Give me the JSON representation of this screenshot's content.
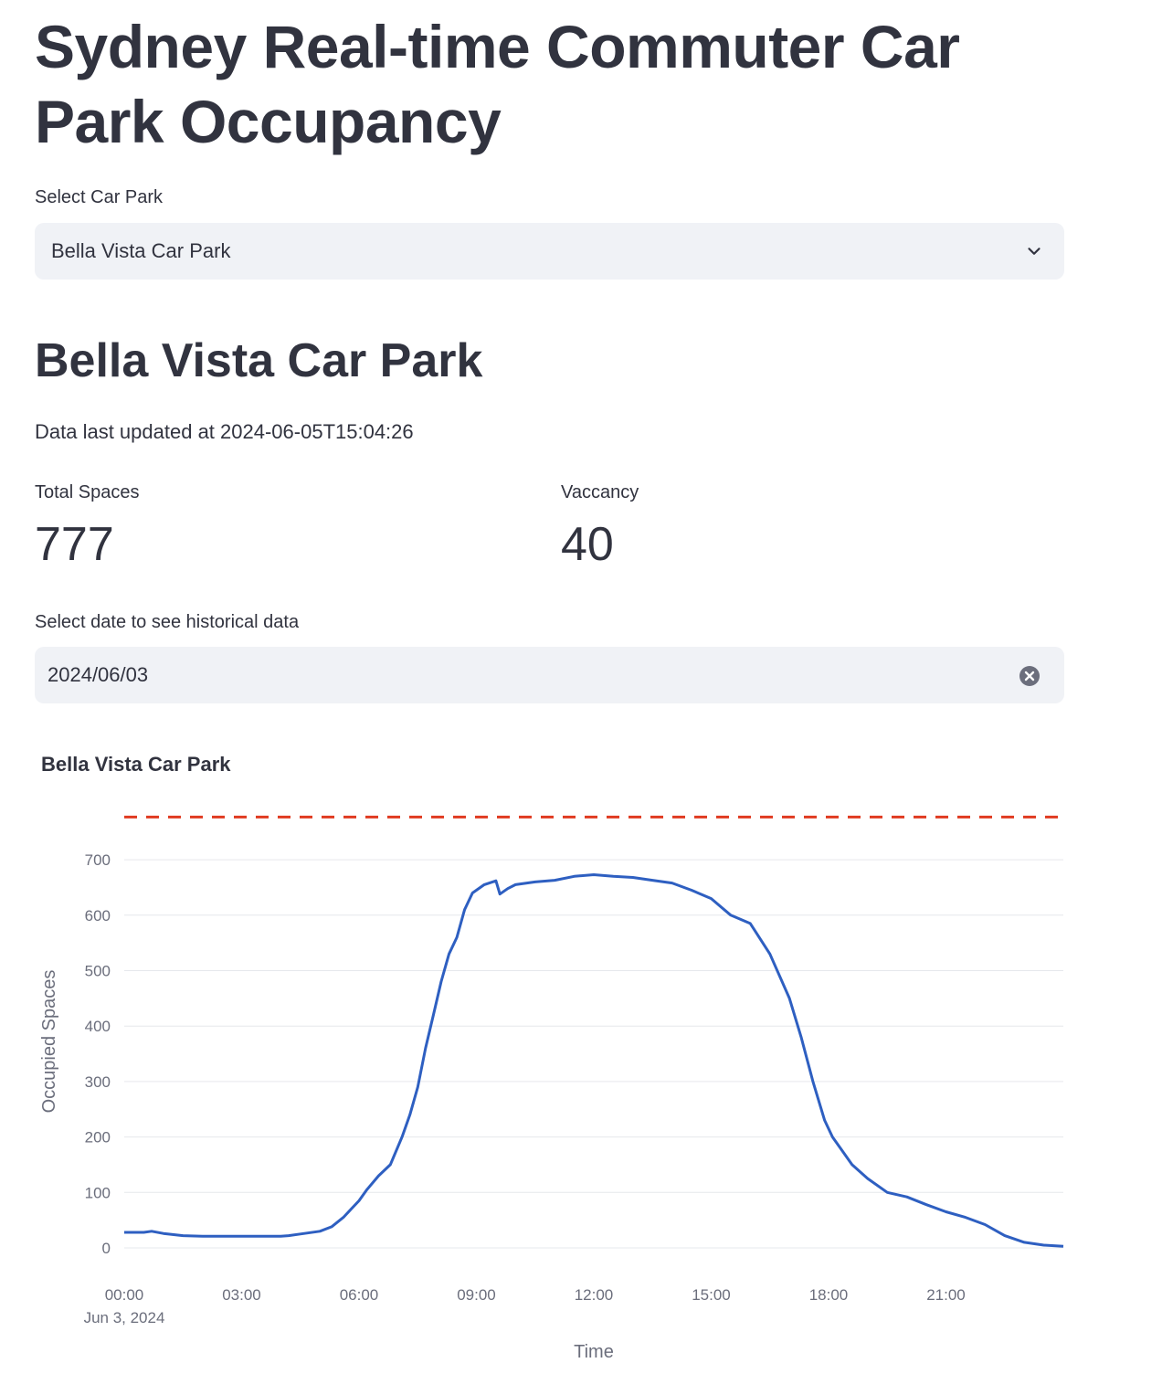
{
  "page": {
    "title": "Sydney Real-time Commuter Car Park Occupancy"
  },
  "carpark_select": {
    "label": "Select Car Park",
    "selected": "Bella Vista Car Park",
    "icon": "chevron-down-icon"
  },
  "section": {
    "heading": "Bella Vista Car Park",
    "updated_text": "Data last updated at 2024-06-05T15:04:26"
  },
  "metrics": {
    "total_label": "Total Spaces",
    "total_value": "777",
    "vacancy_label": "Vaccancy",
    "vacancy_value": "40"
  },
  "date_input": {
    "label": "Select date to see historical data",
    "value": "2024/06/03",
    "icon": "clear-icon"
  },
  "colors": {
    "line": "#2e5fc1",
    "capacity_line": "#e03a20",
    "input_bg": "#f0f2f6"
  },
  "chart_data": {
    "type": "line",
    "title": "Bella Vista Car Park",
    "xlabel": "Time",
    "ylabel": "Occupied Spaces",
    "x_ticks": [
      "00:00",
      "03:00",
      "06:00",
      "09:00",
      "12:00",
      "15:00",
      "18:00",
      "21:00"
    ],
    "x_tick_hours": [
      0,
      3,
      6,
      9,
      12,
      15,
      18,
      21
    ],
    "x_date_label": "Jun 3, 2024",
    "x_range_hours": [
      0,
      24
    ],
    "y_ticks": [
      0,
      100,
      200,
      300,
      400,
      500,
      600,
      700
    ],
    "ylim": [
      0,
      777
    ],
    "grid": true,
    "capacity": 777,
    "series": [
      {
        "x_hours": [
          0,
          0.5,
          0.7,
          1.0,
          1.5,
          2.0,
          3.0,
          4.0,
          4.2,
          4.5,
          5.0,
          5.3,
          5.6,
          5.8,
          6.0,
          6.2,
          6.5,
          6.8,
          7.1,
          7.3,
          7.5,
          7.7,
          7.9,
          8.1,
          8.3,
          8.5,
          8.7,
          8.9,
          9.2,
          9.5,
          9.6,
          9.8,
          10.0,
          10.5,
          11.0,
          11.5,
          12.0,
          12.5,
          13.0,
          13.5,
          14.0,
          14.5,
          15.0,
          15.5,
          16.0,
          16.5,
          17.0,
          17.3,
          17.6,
          17.9,
          18.1,
          18.3,
          18.6,
          19.0,
          19.5,
          20.0,
          20.5,
          21.0,
          21.5,
          22.0,
          22.5,
          23.0,
          23.5,
          24.0
        ],
        "values": [
          28,
          28,
          30,
          26,
          22,
          21,
          21,
          21,
          22,
          25,
          30,
          38,
          55,
          70,
          85,
          105,
          130,
          150,
          200,
          240,
          290,
          360,
          420,
          480,
          530,
          560,
          610,
          640,
          655,
          662,
          638,
          648,
          655,
          660,
          663,
          670,
          673,
          670,
          668,
          663,
          658,
          645,
          630,
          600,
          585,
          530,
          450,
          380,
          300,
          230,
          200,
          180,
          150,
          125,
          100,
          92,
          78,
          65,
          55,
          42,
          22,
          10,
          5,
          3
        ]
      }
    ]
  }
}
